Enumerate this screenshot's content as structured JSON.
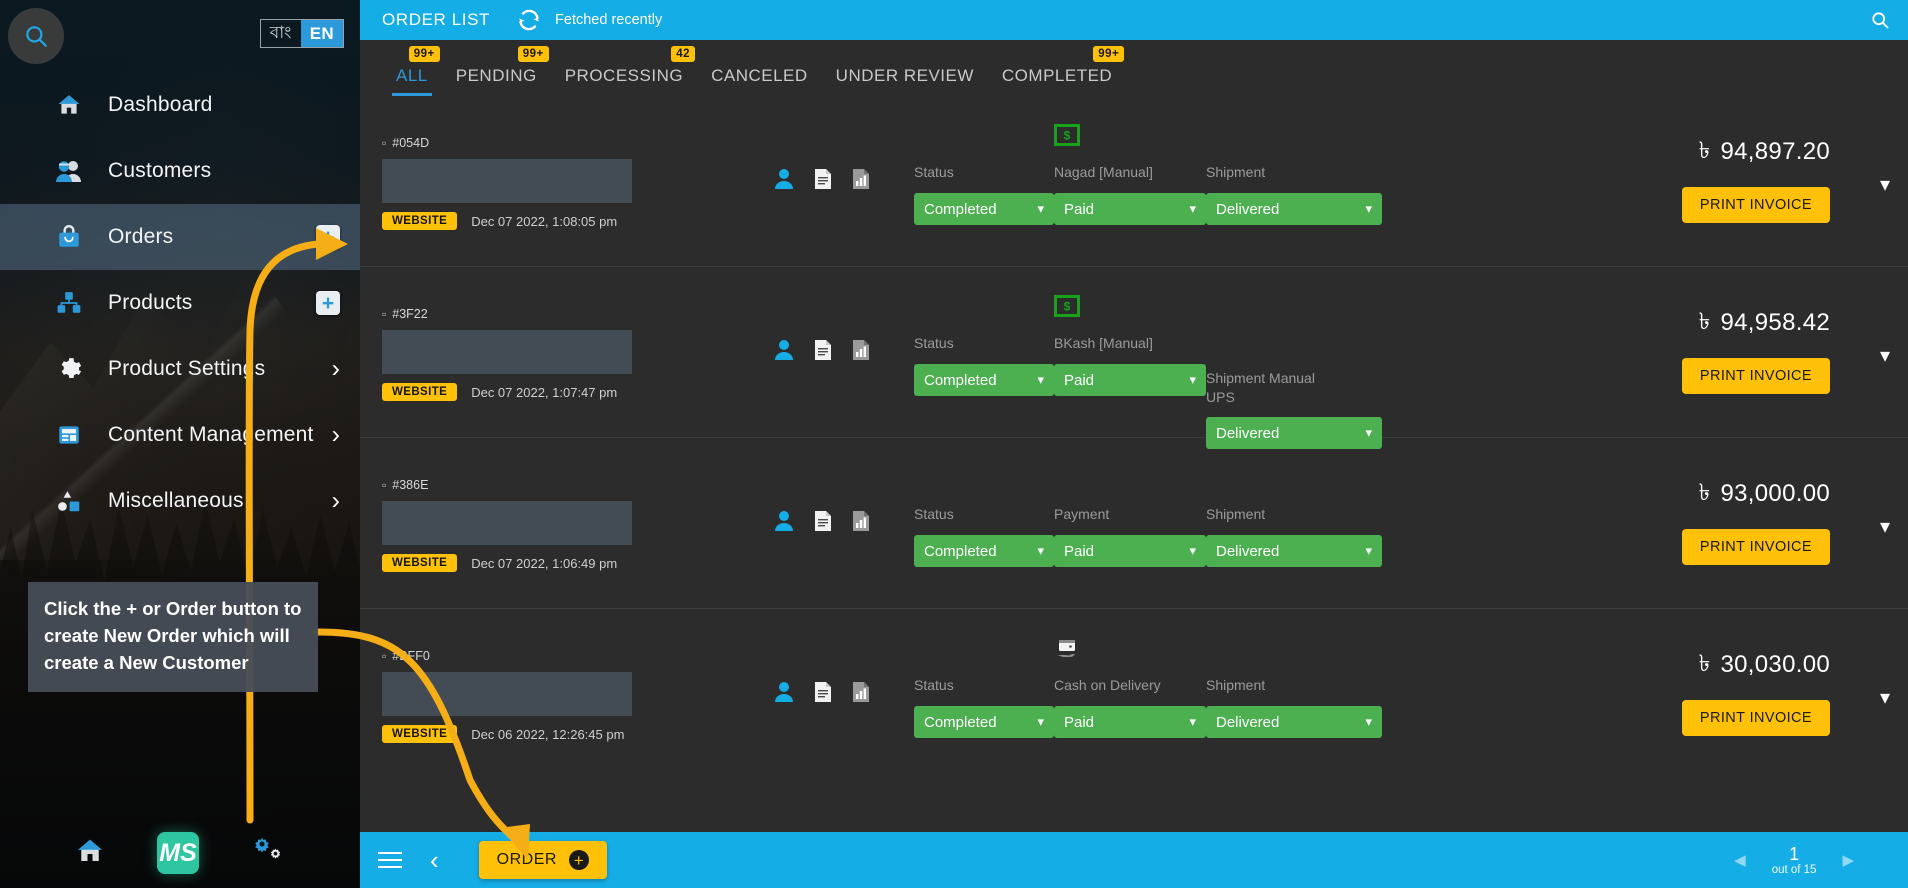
{
  "sidebar": {
    "search_icon": "search-icon",
    "language": {
      "inactive": "বাং",
      "active": "EN"
    },
    "items": [
      {
        "label": "Dashboard",
        "icon": "home-icon",
        "right": "none"
      },
      {
        "label": "Customers",
        "icon": "customers-icon",
        "right": "none"
      },
      {
        "label": "Orders",
        "icon": "orders-bag-icon",
        "right": "plus"
      },
      {
        "label": "Products",
        "icon": "products-boxes-icon",
        "right": "plus"
      },
      {
        "label": "Product Settings",
        "icon": "gear-icon",
        "right": "chevron"
      },
      {
        "label": "Content Management",
        "icon": "content-icon",
        "right": "chevron"
      },
      {
        "label": "Miscellaneous",
        "icon": "shapes-icon",
        "right": "chevron"
      }
    ],
    "bottom_icons": [
      {
        "name": "home-icon",
        "label": ""
      },
      {
        "name": "ms-logo",
        "label": "MS"
      },
      {
        "name": "settings-gears-icon",
        "label": ""
      }
    ]
  },
  "callout": {
    "text": "Click the + or Order button to create New Order which will create a New Customer"
  },
  "topbar": {
    "title": "ORDER LIST",
    "refresh_icon": "refresh-icon",
    "status": "Fetched recently",
    "search_icon": "search-icon"
  },
  "tabs": [
    {
      "label": "ALL",
      "badge": "99+",
      "active": true
    },
    {
      "label": "PENDING",
      "badge": "99+",
      "active": false
    },
    {
      "label": "PROCESSING",
      "badge": "42",
      "active": false
    },
    {
      "label": "CANCELED",
      "badge": "",
      "active": false
    },
    {
      "label": "UNDER REVIEW",
      "badge": "",
      "active": false
    },
    {
      "label": "COMPLETED",
      "badge": "99+",
      "active": false
    }
  ],
  "columns": {
    "status_label": "Status",
    "shipment_label": "Shipment",
    "payment_label": "Payment"
  },
  "orders": [
    {
      "id": "#054D",
      "source": "WEBSITE",
      "date": "Dec 07 2022, 1:08:05 pm",
      "status_label": "Status",
      "status_value": "Completed",
      "payment_label": "Nagad [Manual]",
      "payment_icon": "money-bill-icon",
      "payment_value": "Paid",
      "shipment_label": "Shipment",
      "shipment_value": "Delivered",
      "currency": "৳",
      "amount": "94,897.20",
      "invoice_label": "PRINT INVOICE"
    },
    {
      "id": "#3F22",
      "source": "WEBSITE",
      "date": "Dec 07 2022, 1:07:47 pm",
      "status_label": "Status",
      "status_value": "Completed",
      "payment_label": "BKash [Manual]",
      "payment_icon": "money-bill-icon",
      "payment_value": "Paid",
      "shipment_label": "Shipment Manual UPS",
      "shipment_value": "Delivered",
      "currency": "৳",
      "amount": "94,958.42",
      "invoice_label": "PRINT INVOICE"
    },
    {
      "id": "#386E",
      "source": "WEBSITE",
      "date": "Dec 07 2022, 1:06:49 pm",
      "status_label": "Status",
      "status_value": "Completed",
      "payment_label": "Payment",
      "payment_icon": "none",
      "payment_value": "Paid",
      "shipment_label": "Shipment",
      "shipment_value": "Delivered",
      "currency": "৳",
      "amount": "93,000.00",
      "invoice_label": "PRINT INVOICE"
    },
    {
      "id": "#BFF0",
      "source": "WEBSITE",
      "date": "Dec 06 2022, 12:26:45 pm",
      "status_label": "Status",
      "status_value": "Completed",
      "payment_label": "Cash on Delivery",
      "payment_icon": "cash-on-delivery-icon",
      "payment_value": "Paid",
      "shipment_label": "Shipment",
      "shipment_value": "Delivered",
      "currency": "৳",
      "amount": "30,030.00",
      "invoice_label": "PRINT INVOICE"
    }
  ],
  "bottombar": {
    "menu_icon": "hamburger-icon",
    "back_icon": "chevron-left-icon",
    "order_label": "ORDER",
    "order_plus": "+",
    "pager": {
      "prev": "◀",
      "page": "1",
      "out_of": "out of 15",
      "next": "▶"
    }
  },
  "colors": {
    "accent_blue": "#15ade6",
    "accent_yellow": "#ffc107",
    "status_green": "#4caf50",
    "panel_dark": "#2c2c2c"
  }
}
